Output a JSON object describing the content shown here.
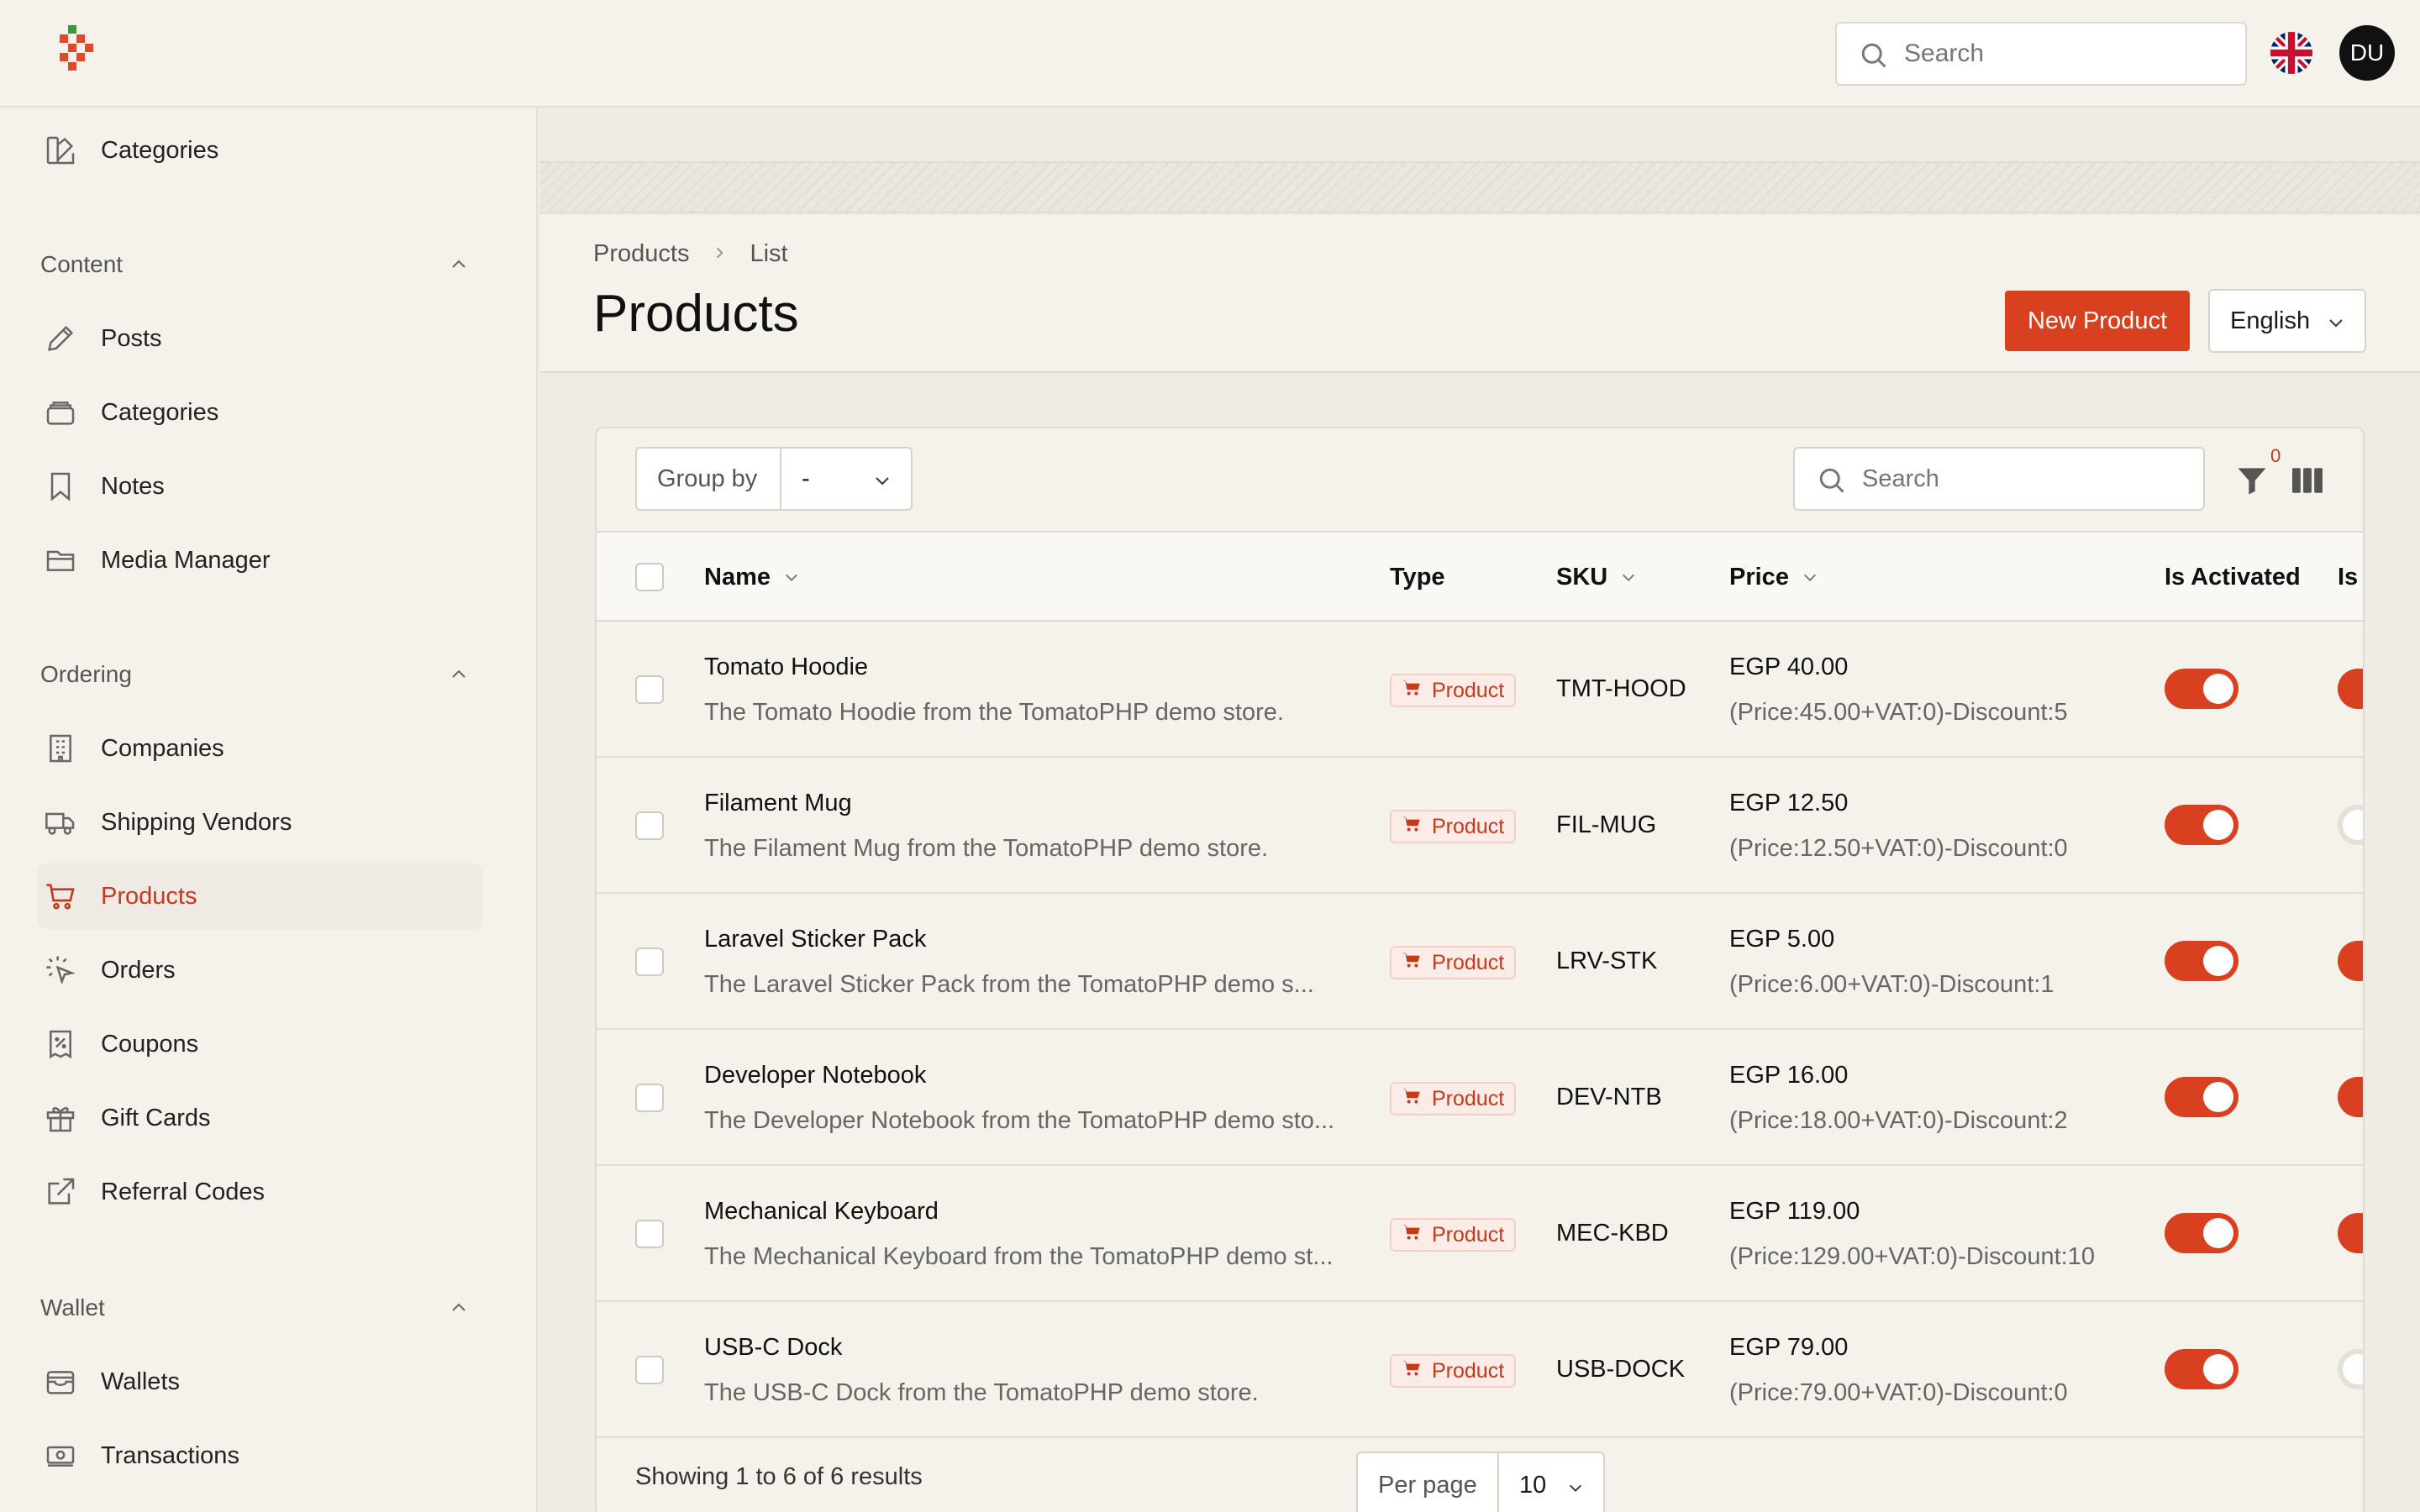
{
  "topbar": {
    "search_placeholder": "Search",
    "avatar_initials": "DU",
    "flag": "uk-flag-icon"
  },
  "sidebar": {
    "top_item": {
      "label": "Categories",
      "icon": "categories-icon"
    },
    "groups": [
      {
        "label": "Content",
        "items": [
          {
            "label": "Posts",
            "icon": "pencil-icon"
          },
          {
            "label": "Categories",
            "icon": "stack-icon"
          },
          {
            "label": "Notes",
            "icon": "bookmark-icon"
          },
          {
            "label": "Media Manager",
            "icon": "folder-icon"
          }
        ]
      },
      {
        "label": "Ordering",
        "items": [
          {
            "label": "Companies",
            "icon": "building-icon"
          },
          {
            "label": "Shipping Vendors",
            "icon": "truck-icon"
          },
          {
            "label": "Products",
            "icon": "cart-icon",
            "active": true
          },
          {
            "label": "Orders",
            "icon": "cursor-click-icon"
          },
          {
            "label": "Coupons",
            "icon": "receipt-percent-icon"
          },
          {
            "label": "Gift Cards",
            "icon": "gift-icon"
          },
          {
            "label": "Referral Codes",
            "icon": "external-link-icon"
          }
        ]
      },
      {
        "label": "Wallet",
        "items": [
          {
            "label": "Wallets",
            "icon": "wallet-icon"
          },
          {
            "label": "Transactions",
            "icon": "banknotes-icon"
          }
        ]
      }
    ]
  },
  "header": {
    "breadcrumb": [
      "Products",
      "List"
    ],
    "title": "Products",
    "new_button": "New Product",
    "language": "English"
  },
  "table": {
    "group_by_label": "Group by",
    "group_by_value": "-",
    "search_placeholder": "Search",
    "filter_count": "0",
    "columns": [
      "Name",
      "Type",
      "SKU",
      "Price",
      "Is Activated",
      "Is T"
    ],
    "rows": [
      {
        "name": "Tomato Hoodie",
        "desc": "The Tomato Hoodie from the TomatoPHP demo store.",
        "type": "Product",
        "sku": "TMT-HOOD",
        "price": "EGP 40.00",
        "breakdown": "(Price:45.00+VAT:0)-Discount:5",
        "activated": true,
        "second": true
      },
      {
        "name": "Filament Mug",
        "desc": "The Filament Mug from the TomatoPHP demo store.",
        "type": "Product",
        "sku": "FIL-MUG",
        "price": "EGP 12.50",
        "breakdown": "(Price:12.50+VAT:0)-Discount:0",
        "activated": true,
        "second": false
      },
      {
        "name": "Laravel Sticker Pack",
        "desc": "The Laravel Sticker Pack from the TomatoPHP demo s...",
        "type": "Product",
        "sku": "LRV-STK",
        "price": "EGP 5.00",
        "breakdown": "(Price:6.00+VAT:0)-Discount:1",
        "activated": true,
        "second": true
      },
      {
        "name": "Developer Notebook",
        "desc": "The Developer Notebook from the TomatoPHP demo sto...",
        "type": "Product",
        "sku": "DEV-NTB",
        "price": "EGP 16.00",
        "breakdown": "(Price:18.00+VAT:0)-Discount:2",
        "activated": true,
        "second": true
      },
      {
        "name": "Mechanical Keyboard",
        "desc": "The Mechanical Keyboard from the TomatoPHP demo st...",
        "type": "Product",
        "sku": "MEC-KBD",
        "price": "EGP 119.00",
        "breakdown": "(Price:129.00+VAT:0)-Discount:10",
        "activated": true,
        "second": true
      },
      {
        "name": "USB-C Dock",
        "desc": "The USB-C Dock from the TomatoPHP demo store.",
        "type": "Product",
        "sku": "USB-DOCK",
        "price": "EGP 79.00",
        "breakdown": "(Price:79.00+VAT:0)-Discount:0",
        "activated": true,
        "second": false
      }
    ],
    "showing": "Showing 1 to 6 of 6 results",
    "per_page_label": "Per page",
    "per_page_value": "10"
  },
  "colors": {
    "accent": "#d9401f",
    "background": "#f3efe8"
  }
}
